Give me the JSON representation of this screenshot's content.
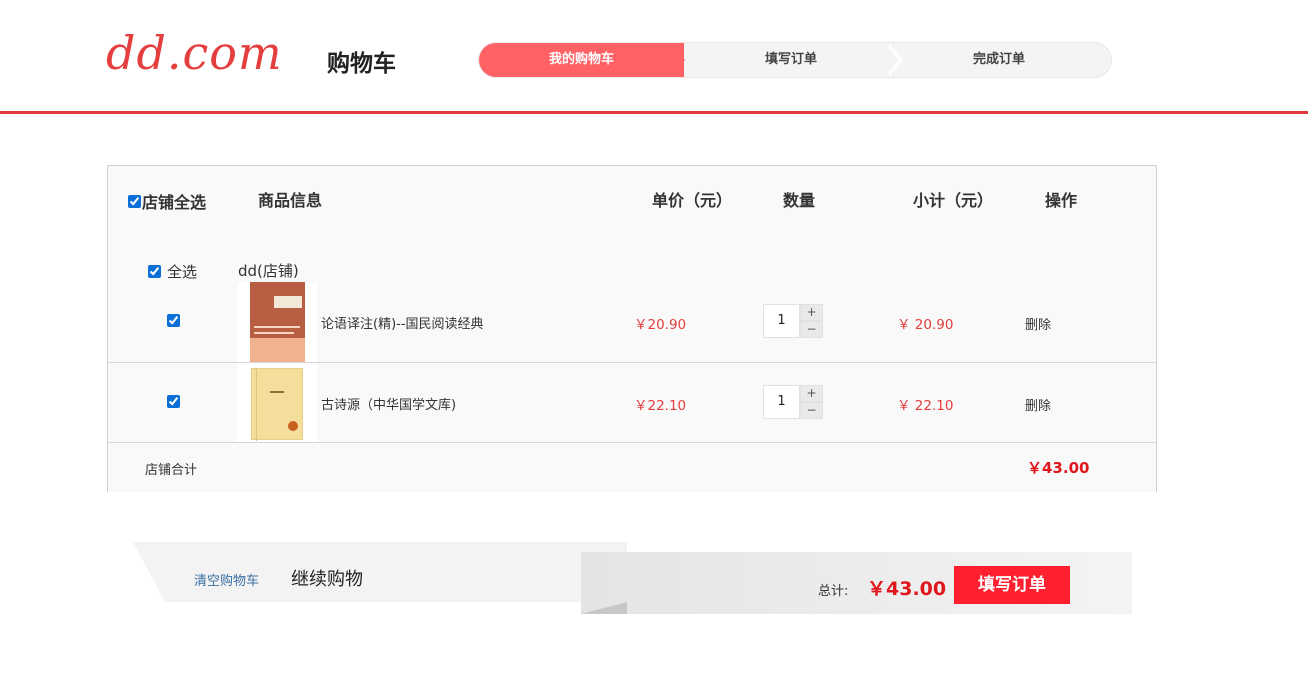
{
  "header": {
    "logo": "dd.com",
    "title": "购物车",
    "steps": [
      "我的购物车",
      "填写订单",
      "完成订单"
    ],
    "active_step": 0
  },
  "colors": {
    "accent": "#e33a3f",
    "step_active": "#ff6165",
    "price_red": "#e0181e",
    "button_red": "#ff1f2e",
    "link_blue": "#3a6fa6"
  },
  "cart": {
    "columns": {
      "select_all_store": "店铺全选",
      "info": "商品信息",
      "price": "单价（元）",
      "qty": "数量",
      "subtotal": "小计（元）",
      "action": "操作"
    },
    "shop": {
      "select_all_label": "全选",
      "name": "dd(店铺)"
    },
    "items": [
      {
        "checked": true,
        "name": "论语译注(精)--国民阅读经典",
        "price": "￥20.90",
        "qty": "1",
        "subtotal": "￥ 20.90",
        "delete": "删除",
        "thumb_icon": "book-cover-lunyu"
      },
      {
        "checked": true,
        "name": "古诗源（中华国学文库)",
        "price": "￥22.10",
        "qty": "1",
        "subtotal": "￥ 22.10",
        "delete": "删除",
        "thumb_icon": "book-cover-gushiyuan"
      }
    ],
    "qty_plus": "+",
    "qty_minus": "−",
    "shop_total_label": "店铺合计",
    "shop_total": "￥43.00"
  },
  "footer": {
    "clear_cart": "清空购物车",
    "continue_shopping": "继续购物",
    "grand_total_label": "总计:",
    "grand_total": "￥43.00",
    "submit": "填写订单"
  }
}
